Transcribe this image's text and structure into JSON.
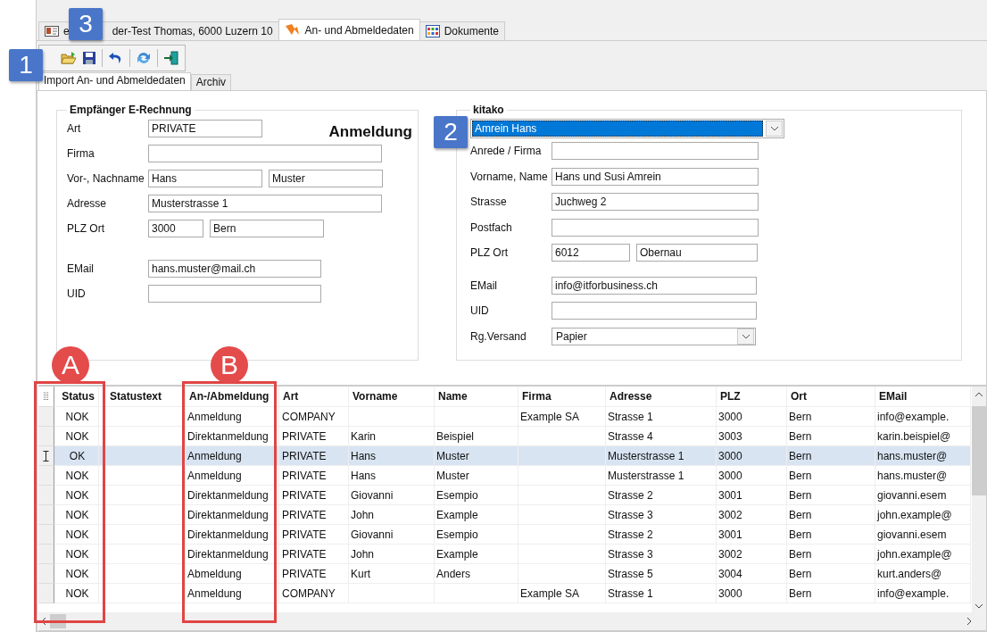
{
  "tabs": [
    {
      "label_start": "e",
      "label_end": "der-Test Thomas, 6000 Luzern 10",
      "selected": false
    },
    {
      "label_end": "An- und Abmeldedaten",
      "selected": true
    },
    {
      "label_end": "Dokumente",
      "selected": false
    }
  ],
  "subtabs": [
    {
      "label": "Import An- und Abmeldedaten",
      "selected": true
    },
    {
      "label": "Archiv",
      "selected": false
    }
  ],
  "recipient_group": {
    "title": "Empfänger E-Rechnung",
    "heading": "Anmeldung",
    "rows": [
      {
        "label": "Art",
        "fields": [
          {
            "value": "PRIVATE"
          }
        ]
      },
      {
        "label": "Firma"
      },
      {
        "label": "Vor-, Nachname",
        "fields": [
          {
            "value": "Hans"
          },
          {
            "value": "Muster"
          }
        ]
      },
      {
        "label": "Adresse",
        "fields": [
          {
            "value": "Musterstrasse 1"
          }
        ]
      },
      {
        "label": "PLZ Ort",
        "fields": [
          {
            "value": "3000"
          },
          {
            "value": "Bern"
          }
        ]
      },
      {
        "label": "EMail",
        "fields": [
          {
            "value": "hans.muster@mail.ch"
          }
        ]
      },
      {
        "label": "UID"
      }
    ]
  },
  "kitako_group": {
    "title": "kitako",
    "combo": {
      "value": "Amrein Hans"
    },
    "rows": [
      {
        "label": "Anrede / Firma"
      },
      {
        "label": "Vorname, Name",
        "fields": [
          {
            "value": "Hans und Susi Amrein"
          }
        ]
      },
      {
        "label": "Strasse",
        "fields": [
          {
            "value": "Juchweg 2"
          }
        ]
      },
      {
        "label": "Postfach"
      },
      {
        "label": "PLZ Ort",
        "fields": [
          {
            "value": "6012"
          },
          {
            "value": "Obernau"
          }
        ]
      },
      {
        "label": "EMail",
        "fields": [
          {
            "value": "info@itforbusiness.ch"
          }
        ]
      },
      {
        "label": "UID"
      },
      {
        "label": "Rg.Versand",
        "fields": [
          {
            "value": "Papier",
            "kind": "dropdown"
          }
        ]
      }
    ]
  },
  "table": {
    "columns": [
      "Status",
      "Statustext",
      "An-/Abmeldung",
      "Art",
      "Vorname",
      "Name",
      "Firma",
      "Adresse",
      "PLZ",
      "Ort",
      "EMail"
    ],
    "rows": [
      {
        "selected": false,
        "cells": [
          "NOK",
          null,
          "Anmeldung",
          "COMPANY",
          null,
          null,
          "Example SA",
          "Strasse 1",
          "3000",
          "Bern",
          "info@example."
        ]
      },
      {
        "selected": false,
        "cells": [
          "NOK",
          null,
          "Direktanmeldung",
          "PRIVATE",
          "Karin",
          "Beispiel",
          null,
          "Strasse 4",
          "3003",
          "Bern",
          "karin.beispiel@"
        ]
      },
      {
        "selected": true,
        "cells": [
          "OK",
          null,
          "Anmeldung",
          "PRIVATE",
          "Hans",
          "Muster",
          null,
          "Musterstrasse 1",
          "3000",
          "Bern",
          "hans.muster@"
        ]
      },
      {
        "selected": false,
        "cells": [
          "NOK",
          null,
          "Anmeldung",
          "PRIVATE",
          "Hans",
          "Muster",
          null,
          "Musterstrasse 1",
          "3000",
          "Bern",
          "hans.muster@"
        ]
      },
      {
        "selected": false,
        "cells": [
          "NOK",
          null,
          "Direktanmeldung",
          "PRIVATE",
          "Giovanni",
          "Esempio",
          null,
          "Strasse 2",
          "3001",
          "Bern",
          "giovanni.esem"
        ]
      },
      {
        "selected": false,
        "cells": [
          "NOK",
          null,
          "Direktanmeldung",
          "PRIVATE",
          "John",
          "Example",
          null,
          "Strasse 3",
          "3002",
          "Bern",
          "john.example@"
        ]
      },
      {
        "selected": false,
        "cells": [
          "NOK",
          null,
          "Direktanmeldung",
          "PRIVATE",
          "Giovanni",
          "Esempio",
          null,
          "Strasse 2",
          "3001",
          "Bern",
          "giovanni.esem"
        ]
      },
      {
        "selected": false,
        "cells": [
          "NOK",
          null,
          "Direktanmeldung",
          "PRIVATE",
          "John",
          "Example",
          null,
          "Strasse 3",
          "3002",
          "Bern",
          "john.example@"
        ]
      },
      {
        "selected": false,
        "cells": [
          "NOK",
          null,
          "Abmeldung",
          "PRIVATE",
          "Kurt",
          "Anders",
          null,
          "Strasse 5",
          "3004",
          "Bern",
          "kurt.anders@"
        ]
      },
      {
        "selected": false,
        "cells": [
          "NOK",
          null,
          "Anmeldung",
          "COMPANY",
          null,
          null,
          "Example SA",
          "Strasse 1",
          "3000",
          "Bern",
          "info@example."
        ]
      }
    ]
  },
  "annotations": [
    {
      "label": "1",
      "kind": "square"
    },
    {
      "label": "3",
      "kind": "square"
    },
    {
      "label": "2",
      "kind": "square"
    },
    {
      "label": "A",
      "kind": "circle"
    },
    {
      "label": "B",
      "kind": "circle"
    }
  ]
}
